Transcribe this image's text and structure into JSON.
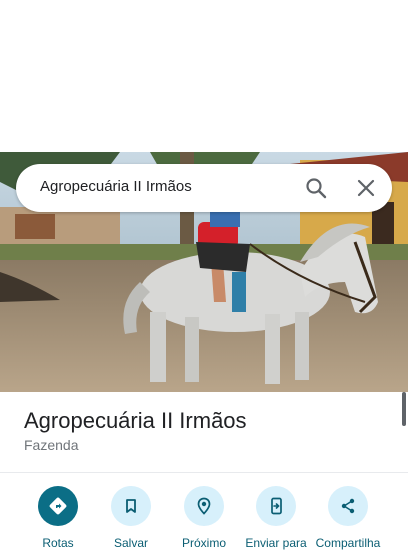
{
  "search": {
    "query": "Agropecuária II Irmãos"
  },
  "place": {
    "title": "Agropecuária II Irmãos",
    "category": "Fazenda"
  },
  "photo": {
    "subject": "horse-and-rider-photo"
  },
  "actions": [
    {
      "label": "Rotas",
      "icon": "directions-icon"
    },
    {
      "label": "Salvar",
      "icon": "bookmark-icon"
    },
    {
      "label": "Próximo",
      "icon": "nearby-icon"
    },
    {
      "label": "Enviar para",
      "icon": "send-to-phone-icon"
    },
    {
      "label": "Compartilha",
      "icon": "share-icon"
    }
  ],
  "colors": {
    "primary_action": "#0b6e86",
    "secondary_action_bg": "#d7f0fb",
    "action_label": "#0b5e73"
  }
}
